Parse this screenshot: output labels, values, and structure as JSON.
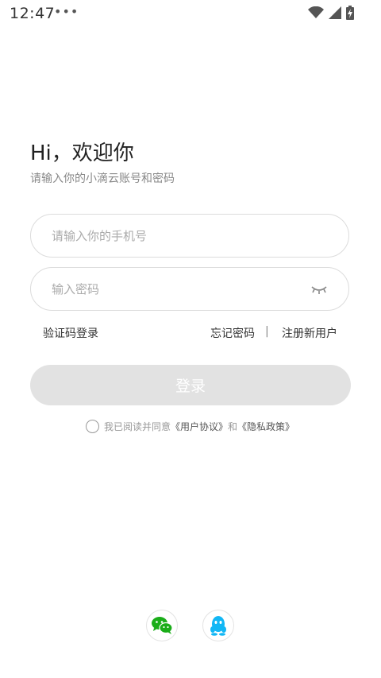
{
  "status_bar": {
    "time": "12:47",
    "overflow": "•••",
    "icons": [
      "wifi-icon",
      "cell-signal-icon",
      "battery-charging-icon"
    ]
  },
  "login": {
    "greeting": "Hi，欢迎你",
    "subtitle": "请输入你的小滴云账号和密码",
    "phone_placeholder": "请输入你的手机号",
    "password_placeholder": "输入密码",
    "sms_login": "验证码登录",
    "forgot_password": "忘记密码",
    "separator": "|",
    "register": "注册新用户",
    "login_button": "登录",
    "agree_prefix": "我已阅读并同意",
    "agreement": "《用户协议》",
    "and": "和",
    "privacy": "《隐私政策》"
  },
  "social": {
    "icons": [
      "wechat-icon",
      "qq-icon"
    ]
  },
  "colors": {
    "wechat_green": "#1aad19",
    "qq_blue": "#12b7f5",
    "button_disabled": "#e2e2e2"
  }
}
